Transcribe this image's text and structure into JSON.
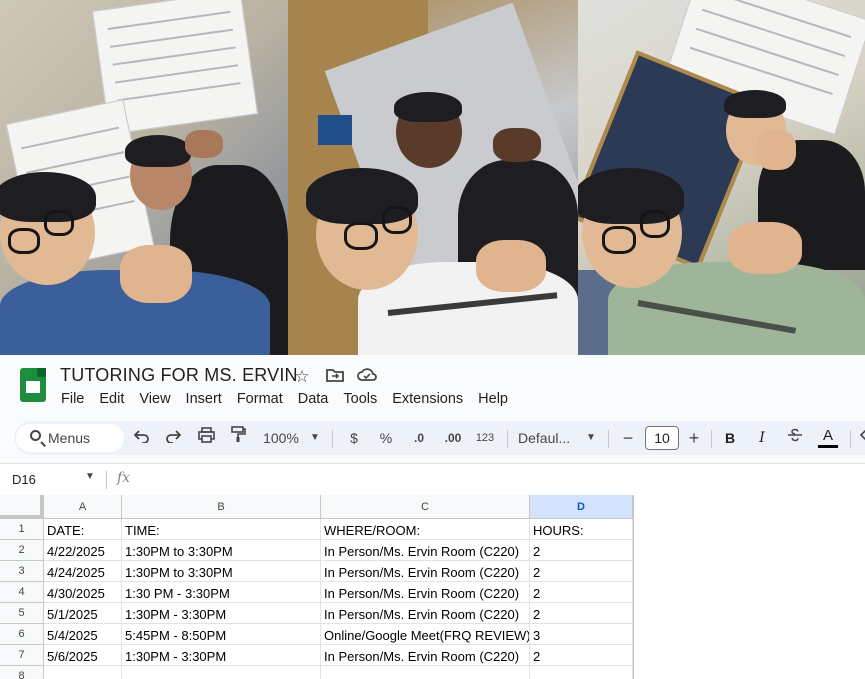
{
  "doc": {
    "title": "TUTORING FOR MS. ERVIN"
  },
  "menu": [
    "File",
    "Edit",
    "View",
    "Insert",
    "Format",
    "Data",
    "Tools",
    "Extensions",
    "Help"
  ],
  "toolbar": {
    "menus_label": "Menus",
    "zoom": "100%",
    "currency": "$",
    "percent": "%",
    "decrease_decimal": ".0",
    "increase_decimal": ".00",
    "number_format": "123",
    "font_family": "Defaul...",
    "font_size": "10",
    "bold": "B",
    "italic": "I",
    "text_color": "A"
  },
  "formula_bar": {
    "cell_ref": "D16",
    "fx": "fx"
  },
  "sheet": {
    "columns": [
      "A",
      "B",
      "C",
      "D"
    ],
    "selected_column": "D",
    "rows": [
      {
        "num": "1",
        "cells": [
          "DATE:",
          "TIME:",
          "WHERE/ROOM:",
          "HOURS:"
        ]
      },
      {
        "num": "2",
        "cells": [
          "4/22/2025",
          "1:30PM to 3:30PM",
          "In Person/Ms. Ervin Room (C220)",
          "2"
        ]
      },
      {
        "num": "3",
        "cells": [
          "4/24/2025",
          "1:30PM to 3:30PM",
          "In Person/Ms. Ervin Room (C220)",
          "2"
        ]
      },
      {
        "num": "4",
        "cells": [
          "4/30/2025",
          "1:30 PM - 3:30PM",
          "In Person/Ms. Ervin Room (C220)",
          "2"
        ]
      },
      {
        "num": "5",
        "cells": [
          "5/1/2025",
          "1:30PM - 3:30PM",
          "In Person/Ms. Ervin Room (C220)",
          "2"
        ]
      },
      {
        "num": "6",
        "cells": [
          "5/4/2025",
          "5:45PM - 8:50PM",
          "Online/Google Meet(FRQ REVIEW)",
          "3"
        ]
      },
      {
        "num": "7",
        "cells": [
          "5/6/2025",
          "1:30PM - 3:30PM",
          "In Person/Ms. Ervin Room (C220)",
          "2"
        ]
      },
      {
        "num": "8",
        "cells": [
          "",
          "",
          "",
          ""
        ]
      }
    ]
  },
  "colors": {
    "sheets_green": "#1e8e3e",
    "selected_header": "#d3e3fd",
    "toolbar_bg": "#edf2fa"
  }
}
